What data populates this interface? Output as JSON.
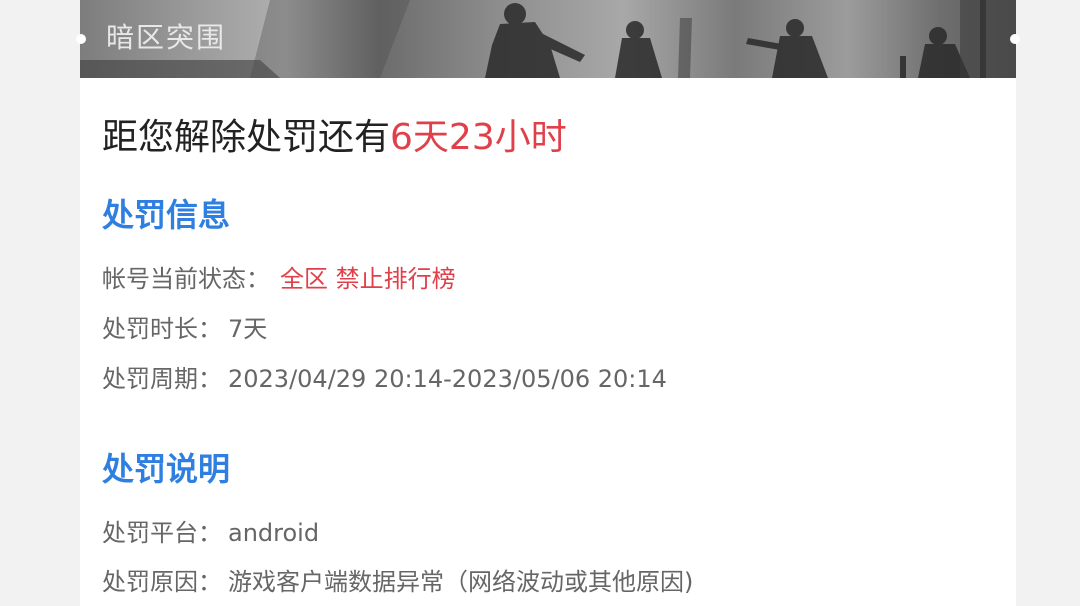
{
  "banner": {
    "title": "暗区突围"
  },
  "countdown": {
    "prefix": "距您解除处罚还有",
    "remaining": "6天23小时"
  },
  "penalty_info": {
    "title": "处罚信息",
    "rows": [
      {
        "label": "帐号当前状态：",
        "value": "全区 禁止排行榜"
      },
      {
        "label": "处罚时长：",
        "value": "7天"
      },
      {
        "label": "处罚周期：",
        "value": "2023/04/29 20:14-2023/05/06 20:14"
      }
    ]
  },
  "penalty_desc": {
    "title": "处罚说明",
    "rows": [
      {
        "label": "处罚平台：",
        "value": "android"
      },
      {
        "label": "处罚原因：",
        "value": "游戏客户端数据异常（网络波动或其他原因)"
      }
    ]
  },
  "colors": {
    "highlight": "#e0404a",
    "section_title": "#2f7fe0",
    "body_text": "#666666"
  }
}
